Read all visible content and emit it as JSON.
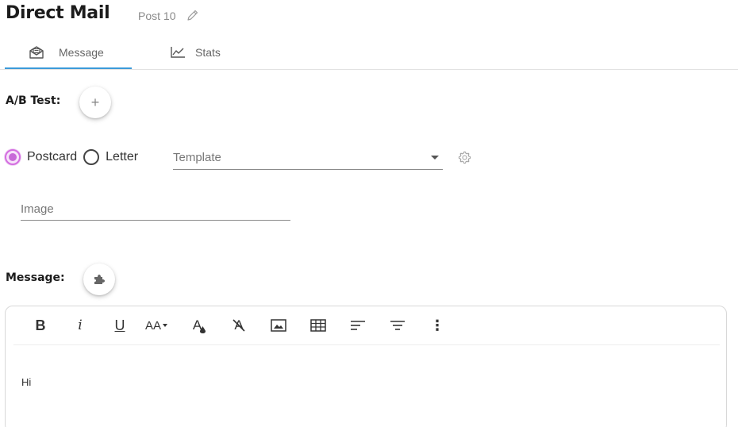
{
  "header": {
    "title": "Direct Mail",
    "post_label": "Post 10",
    "edit_icon": "pencil-icon"
  },
  "tabs": [
    {
      "label": "Message",
      "icon": "envelope-open-icon",
      "active": true
    },
    {
      "label": "Stats",
      "icon": "line-chart-icon",
      "active": false
    }
  ],
  "colors": {
    "tab_indicator": "#3b9ad9",
    "radio_accent": "#c86ad8"
  },
  "ab_test": {
    "label": "A/B Test:",
    "add_glyph": "+"
  },
  "format": {
    "options": [
      {
        "label": "Postcard",
        "selected": true
      },
      {
        "label": "Letter",
        "selected": false
      }
    ],
    "template_placeholder": "Template",
    "settings_icon": "gear-icon"
  },
  "image_field": {
    "placeholder": "Image"
  },
  "message": {
    "label": "Message:",
    "merge_icon": "puzzle-icon"
  },
  "editor": {
    "toolbar": [
      {
        "name": "bold-button",
        "glyph": "B"
      },
      {
        "name": "italic-button",
        "glyph": "i"
      },
      {
        "name": "underline-button",
        "glyph": "U"
      },
      {
        "name": "font-size-button",
        "glyph": "AA"
      },
      {
        "name": "text-color-button",
        "glyph": "A"
      },
      {
        "name": "clear-format-button",
        "glyph": "A"
      },
      {
        "name": "insert-image-button",
        "glyph": ""
      },
      {
        "name": "insert-table-button",
        "glyph": ""
      },
      {
        "name": "align-left-button",
        "glyph": ""
      },
      {
        "name": "align-center-button",
        "glyph": ""
      },
      {
        "name": "more-options-button",
        "glyph": "⋮"
      }
    ],
    "content": "Hi"
  }
}
